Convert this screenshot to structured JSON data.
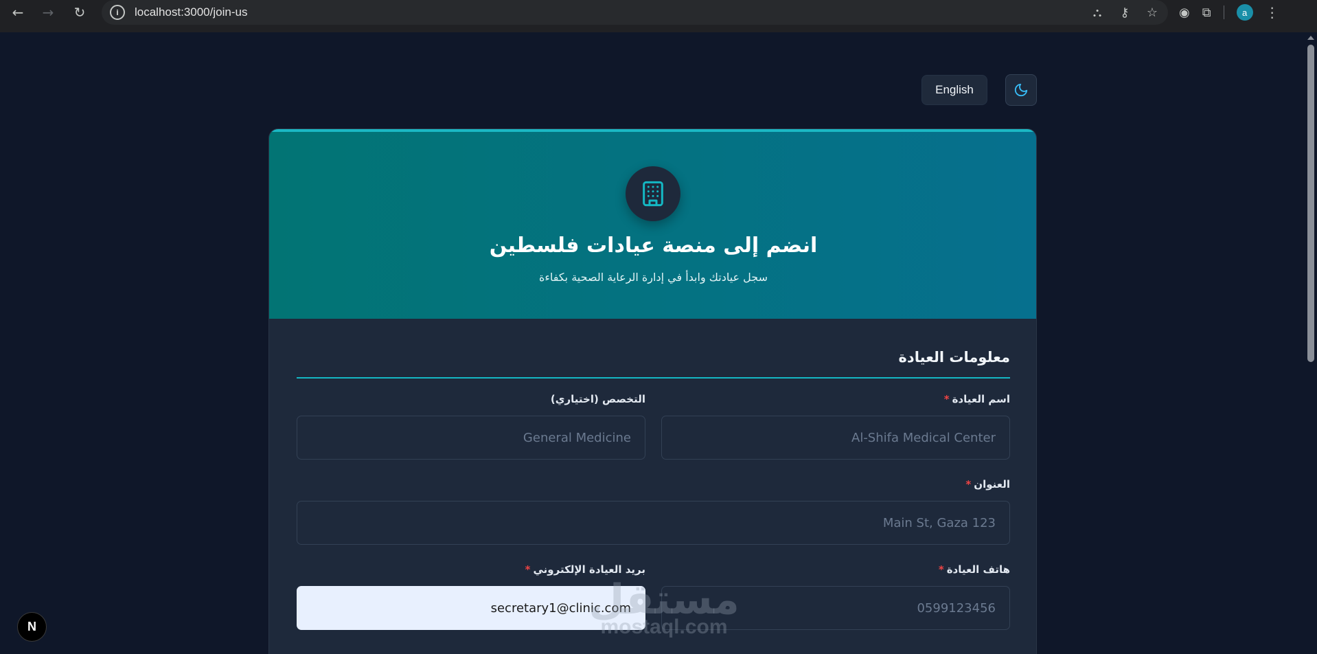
{
  "browser": {
    "url": "localhost:3000/join-us",
    "profile_initial": "a"
  },
  "controls": {
    "language_label": "English"
  },
  "header": {
    "title": "انضم إلى منصة عيادات فلسطين",
    "subtitle": "سجل عيادتك وابدأ في إدارة الرعاية الصحية بكفاءة",
    "icon": "building-icon"
  },
  "form": {
    "section_title": "معلومات العيادة",
    "required_mark": "*",
    "clinic_name": {
      "label": "اسم العيادة",
      "placeholder": "Al-Shifa Medical Center",
      "value": ""
    },
    "specialty": {
      "label": "التخصص (اختياري)",
      "placeholder": "General Medicine",
      "value": ""
    },
    "address": {
      "label": "العنوان",
      "placeholder": "Main St, Gaza 123",
      "value": ""
    },
    "phone": {
      "label": "هاتف العيادة",
      "placeholder": "0599123456",
      "value": ""
    },
    "email": {
      "label": "بريد العيادة الإلكتروني",
      "placeholder": "",
      "value": "secretary1@clinic.com"
    }
  },
  "watermark": {
    "main": "مستقل",
    "sub": "mostaql.com"
  },
  "dev_badge": {
    "label": "N"
  },
  "colors": {
    "page_bg": "#0f1729",
    "card_bg": "#1e293b",
    "header_gradient_start": "#027474",
    "header_gradient_end": "#06708e",
    "accent": "#14b8c4",
    "required": "#ef4444"
  }
}
